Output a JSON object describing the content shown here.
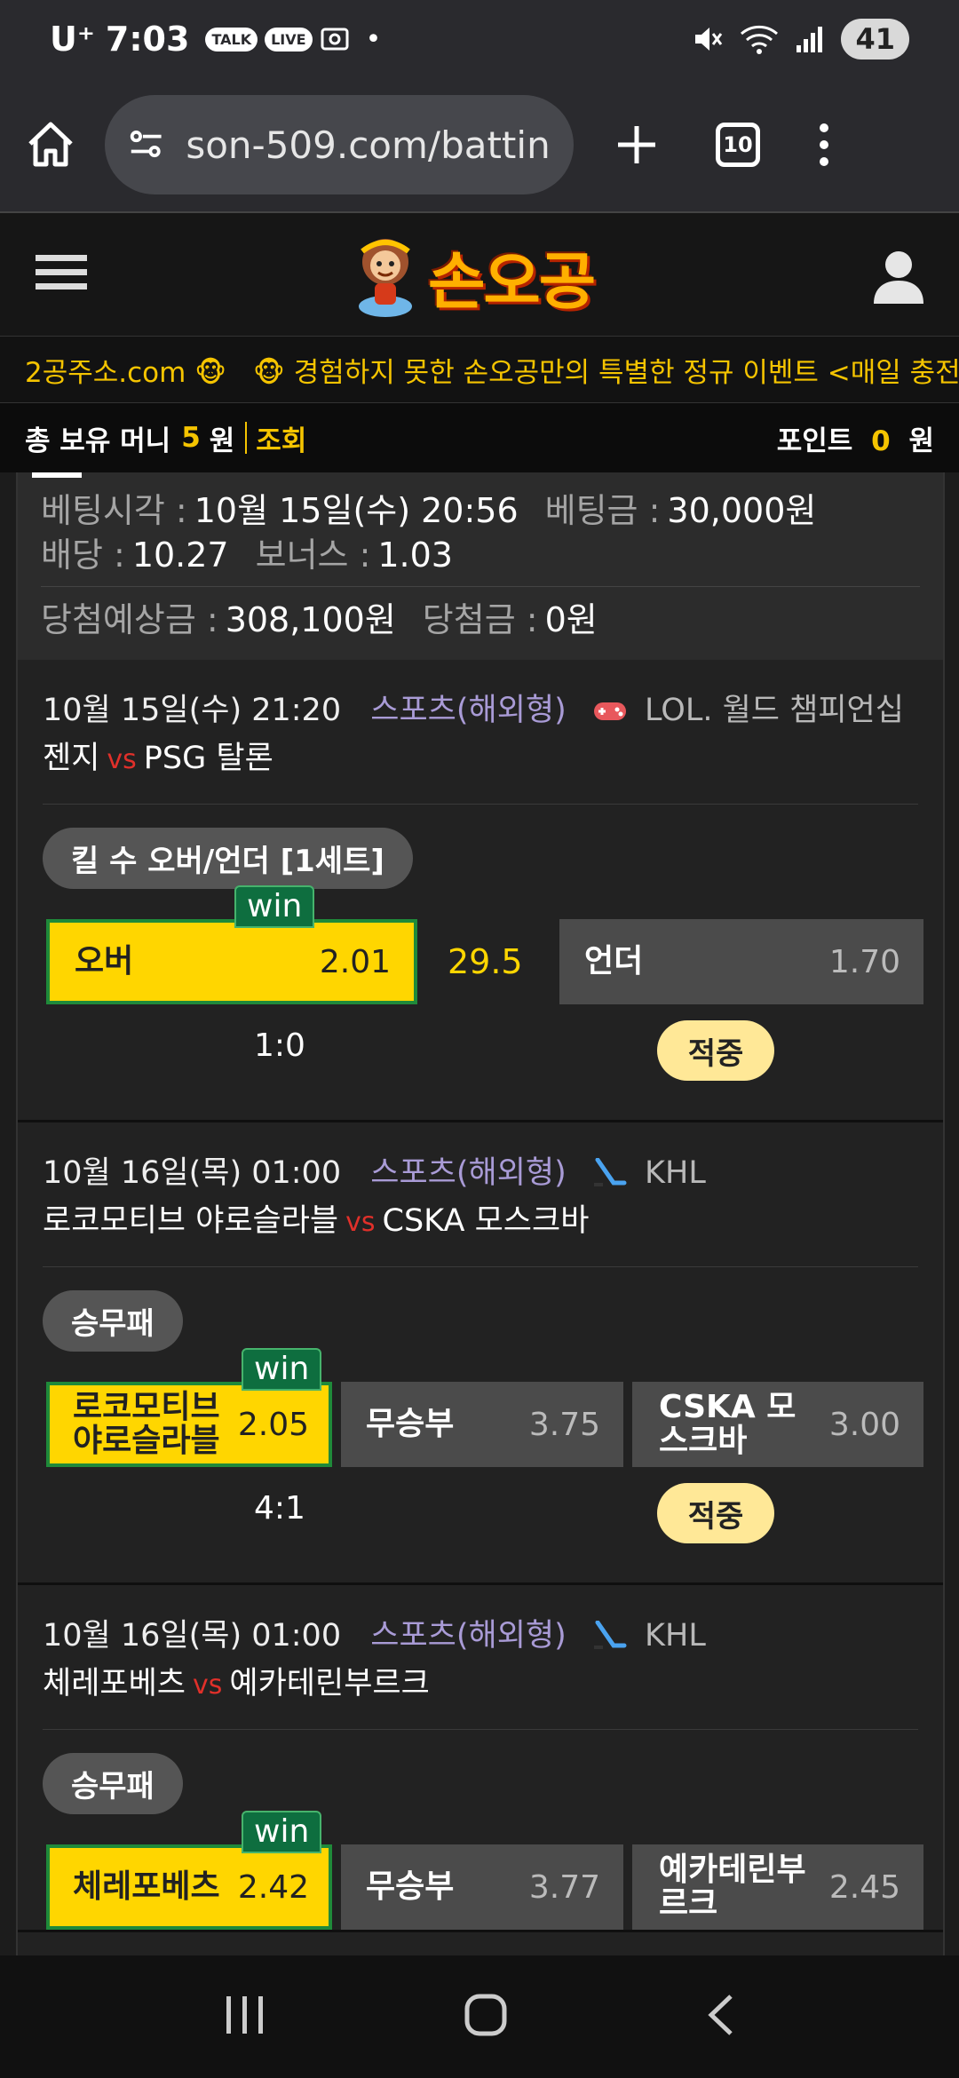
{
  "status": {
    "carrier": "U⁺",
    "time": "7:03",
    "pill_talk": "TALK",
    "pill_live": "LIVE",
    "battery": "41",
    "wifi_level": "5"
  },
  "browser": {
    "url": "son-509.com/batting",
    "tab_count": "10"
  },
  "site": {
    "logo_text": "손오공"
  },
  "marquee": {
    "items": [
      "2공주소.com 🐵",
      "🐵 경험하지 못한 손오공만의 특별한 정규 이벤트 <매일 충전"
    ]
  },
  "money": {
    "label": "총 보유 머니",
    "amount": "5",
    "unit": "원",
    "lookup": "조회",
    "point_label": "포인트",
    "point_amount": "0",
    "point_unit": "원"
  },
  "summary": {
    "bet_time_label": "베팅시각 :",
    "bet_time": "10월 15일(수) 20:56",
    "bet_amount_label": "베팅금 :",
    "bet_amount": "30,000원",
    "odds_label": "배당 :",
    "odds": "10.27",
    "bonus_label": "보너스 :",
    "bonus": "1.03",
    "expected_label": "당첨예상금 :",
    "expected": "308,100원",
    "win_label": "당첨금 :",
    "win_amount": "0원"
  },
  "bets": [
    {
      "date": "10월 15일(수) 21:20",
      "category": "스포츠(해외형)",
      "league_icon": "gamepad-icon",
      "league": "LOL. 월드 챔피언십",
      "home": "젠지",
      "vs": "vs",
      "away": "PSG 탈론",
      "market": "킬 수 오버/언더 [1세트]",
      "option1_name": "오버",
      "option1_odd": "2.01",
      "line": "29.5",
      "option3_name": "언더",
      "option3_odd": "1.70",
      "win": "win",
      "score": "1:0",
      "result": "적중"
    },
    {
      "date": "10월 16일(목) 01:00",
      "category": "스포츠(해외형)",
      "league_icon": "hockey-stick-icon",
      "league": "KHL",
      "home": "로코모티브 야로슬라블",
      "vs": "vs",
      "away": "CSKA 모스크바",
      "market": "승무패",
      "option1_name": "로코모티브 야로슬라블",
      "option1_odd": "2.05",
      "option2_name": "무승부",
      "option2_odd": "3.75",
      "option3_name": "CSKA 모스크바",
      "option3_odd": "3.00",
      "win": "win",
      "score": "4:1",
      "result": "적중"
    },
    {
      "date": "10월 16일(목) 01:00",
      "category": "스포츠(해외형)",
      "league_icon": "hockey-stick-icon",
      "league": "KHL",
      "home": "체레포베츠",
      "vs": "vs",
      "away": "예카테린부르크",
      "market": "승무패",
      "option1_name": "체레포베츠",
      "option1_odd": "2.42",
      "option2_name": "무승부",
      "option2_odd": "3.77",
      "option3_name": "예카테린부르크",
      "option3_odd": "2.45",
      "win": "win"
    }
  ]
}
